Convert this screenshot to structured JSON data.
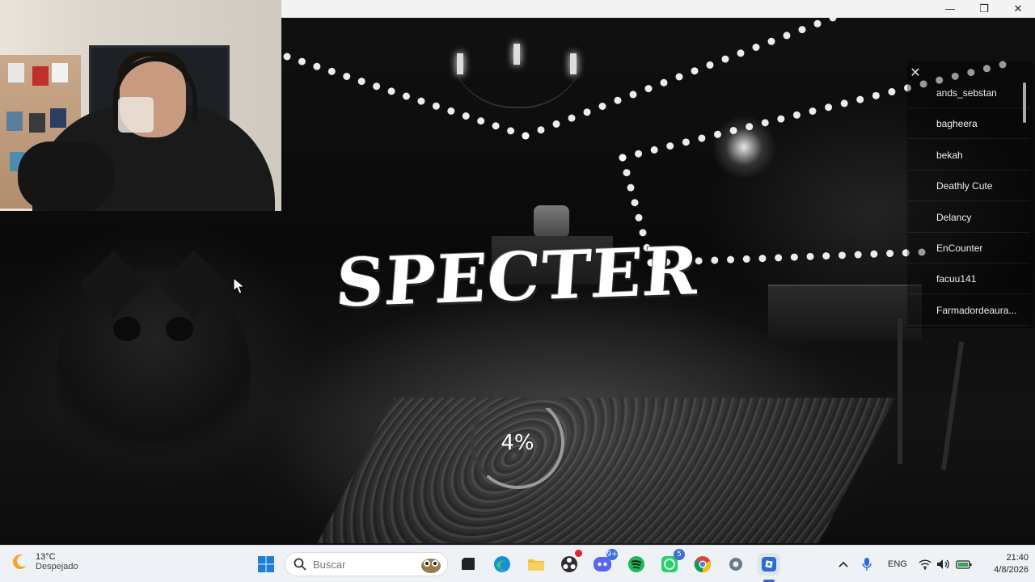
{
  "window": {
    "minimize_glyph": "—",
    "maximize_glyph": "❐",
    "close_glyph": "✕"
  },
  "game": {
    "title": "SPECTER",
    "loading_percent": 4,
    "loading_text": "4%"
  },
  "player_list": {
    "close_glyph": "✕",
    "players": [
      "ands_sebstan",
      "bagheera",
      "bekah",
      "Deathly Cute",
      "Delancy",
      "EnCounter",
      "facuu141",
      "Farmadordeaura..."
    ]
  },
  "taskbar": {
    "weather": {
      "temperature": "13°C",
      "condition": "Despejado",
      "icon": "moon-icon"
    },
    "search_placeholder": "Buscar",
    "apps": [
      {
        "name": "start",
        "icon": "windows-icon"
      },
      {
        "name": "task-view",
        "icon": "task-view-icon"
      },
      {
        "name": "edge",
        "icon": "edge-icon"
      },
      {
        "name": "file-explorer",
        "icon": "folder-icon"
      },
      {
        "name": "obs",
        "icon": "obs-icon"
      },
      {
        "name": "discord",
        "icon": "discord-icon",
        "badge": "9+"
      },
      {
        "name": "spotify",
        "icon": "spotify-icon"
      },
      {
        "name": "whatsapp",
        "icon": "whatsapp-icon",
        "badge": "5"
      },
      {
        "name": "chrome",
        "icon": "chrome-icon"
      },
      {
        "name": "settings",
        "icon": "gear-icon"
      },
      {
        "name": "roblox",
        "icon": "roblox-icon"
      }
    ],
    "language": "ENG",
    "time": "21:40",
    "date": "4/8/2026"
  },
  "colors": {
    "taskbar_bg": "#eef1f6",
    "accent": "#2b6cd4",
    "loader_track": "#3a3a3a",
    "loader_arc": "#9a9a9a"
  }
}
